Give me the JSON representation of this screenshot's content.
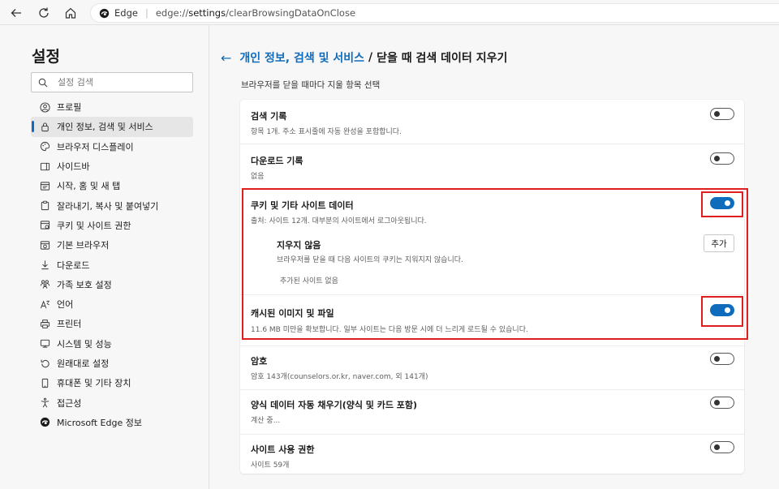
{
  "browser": {
    "site_label": "Edge",
    "url_scheme": "edge://",
    "url_host": "settings",
    "url_path": "/clearBrowsingDataOnClose"
  },
  "sidebar": {
    "title": "설정",
    "search_placeholder": "설정 검색",
    "items": [
      {
        "label": "프로필",
        "icon": "profile-icon"
      },
      {
        "label": "개인 정보, 검색 및 서비스",
        "icon": "lock-icon",
        "active": true
      },
      {
        "label": "브라우저 디스플레이",
        "icon": "palette-icon"
      },
      {
        "label": "사이드바",
        "icon": "sidebar-icon"
      },
      {
        "label": "시작, 홈 및 새 탭",
        "icon": "home-icon"
      },
      {
        "label": "잘라내기, 복사 및 붙여넣기",
        "icon": "clipboard-icon"
      },
      {
        "label": "쿠키 및 사이트 권한",
        "icon": "cookie-icon"
      },
      {
        "label": "기본 브라우저",
        "icon": "browser-icon"
      },
      {
        "label": "다운로드",
        "icon": "download-icon"
      },
      {
        "label": "가족 보호 설정",
        "icon": "family-icon"
      },
      {
        "label": "언어",
        "icon": "language-icon"
      },
      {
        "label": "프린터",
        "icon": "printer-icon"
      },
      {
        "label": "시스템 및 성능",
        "icon": "system-icon"
      },
      {
        "label": "원래대로 설정",
        "icon": "reset-icon"
      },
      {
        "label": "휴대폰 및 기타 장치",
        "icon": "phone-icon"
      },
      {
        "label": "접근성",
        "icon": "accessibility-icon"
      },
      {
        "label": "Microsoft Edge 정보",
        "icon": "edge-logo-icon"
      }
    ]
  },
  "header": {
    "breadcrumb_parent": "개인 정보, 검색 및 서비스",
    "separator": "/",
    "current": "닫을 때 검색 데이터 지우기",
    "subtitle": "브라우저를 닫을 때마다 지울 항목 선택"
  },
  "settings": {
    "history": {
      "title": "검색 기록",
      "desc": "항목 1개. 주소 표시줄에 자동 완성을 포함합니다.",
      "enabled": false
    },
    "downloads": {
      "title": "다운로드 기록",
      "desc": "없음",
      "enabled": false
    },
    "cookies": {
      "title": "쿠키 및 기타 사이트 데이터",
      "desc": "출처: 사이트 12개. 대부분의 사이트에서 로그아웃됩니다.",
      "enabled": true,
      "dont_clear_title": "지우지 않음",
      "dont_clear_desc": "브라우저를 닫을 때 다음 사이트의 쿠키는 지워지지 않습니다.",
      "add_label": "추가",
      "empty_label": "추가된 사이트 없음"
    },
    "cache": {
      "title": "캐시된 이미지 및 파일",
      "desc": "11.6 MB 미만을 확보합니다. 일부 사이트는 다음 방문 시에 더 느리게 로드될 수 있습니다.",
      "enabled": true
    },
    "passwords": {
      "title": "암호",
      "desc": "암호 143개(counselors.or.kr, naver.com, 외 141개)",
      "enabled": false
    },
    "autofill": {
      "title": "양식 데이터 자동 채우기(양식 및 카드 포함)",
      "desc": "계산 중...",
      "enabled": false
    },
    "site_permissions": {
      "title": "사이트 사용 권한",
      "desc": "사이트 59개",
      "enabled": false
    }
  },
  "colors": {
    "accent": "#0f6cbd",
    "highlight": "#e01e1e"
  }
}
